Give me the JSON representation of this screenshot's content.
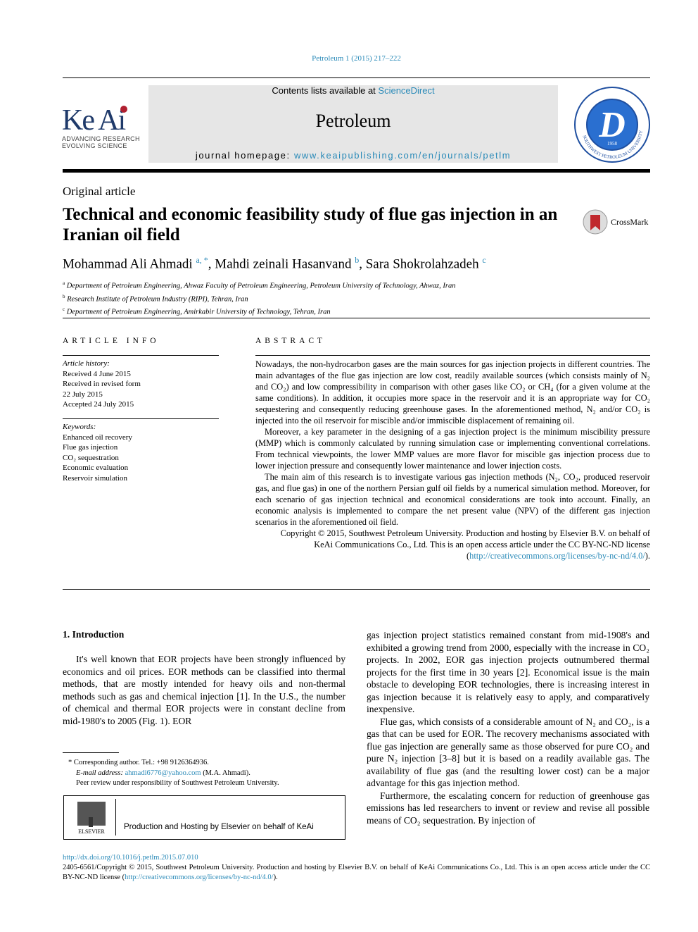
{
  "citation": "Petroleum 1 (2015) 217–222",
  "header": {
    "contents_prefix": "Contents lists available at ",
    "contents_link": "ScienceDirect",
    "journal": "Petroleum",
    "homepage_prefix": "journal homepage: ",
    "homepage_link": "www.keaipublishing.com/en/journals/petlm",
    "logo_keai": "Ke Ai",
    "logo_tag1": "ADVANCING RESEARCH",
    "logo_tag2": "EVOLVING SCIENCE",
    "seal_year": "1958",
    "seal_text": "SOUTHWEST PETROLEUM UNIVERSITY"
  },
  "article_type": "Original article",
  "title": "Technical and economic feasibility study of flue gas injection in an Iranian oil field",
  "crossmark": "CrossMark",
  "authors": [
    {
      "name": "Mohammad Ali Ahmadi",
      "sup": "a, *"
    },
    {
      "name": "Mahdi zeinali Hasanvand",
      "sup": "b"
    },
    {
      "name": "Sara Shokrolahzadeh",
      "sup": "c"
    }
  ],
  "affiliations": [
    {
      "sup": "a",
      "text": "Department of Petroleum Engineering, Ahwaz Faculty of Petroleum Engineering, Petroleum University of Technology, Ahwaz, Iran"
    },
    {
      "sup": "b",
      "text": "Research Institute of Petroleum Industry (RIPI), Tehran, Iran"
    },
    {
      "sup": "c",
      "text": "Department of Petroleum Engineering, Amirkabir University of Technology, Tehran, Iran"
    }
  ],
  "article_info": {
    "heading": "ARTICLE INFO",
    "history_label": "Article history:",
    "history": [
      "Received 4 June 2015",
      "Received in revised form",
      "22 July 2015",
      "Accepted 24 July 2015"
    ],
    "keywords_label": "Keywords:",
    "keywords": [
      "Enhanced oil recovery",
      "Flue gas injection",
      "CO₂ sequestration",
      "Economic evaluation",
      "Reservoir simulation"
    ]
  },
  "abstract": {
    "heading": "ABSTRACT",
    "paragraphs": [
      "Nowadays, the non-hydrocarbon gases are the main sources for gas injection projects in different countries. The main advantages of the flue gas injection are low cost, readily available sources (which consists mainly of N₂ and CO₂) and low compressibility in comparison with other gases like CO₂ or CH₄ (for a given volume at the same conditions). In addition, it occupies more space in the reservoir and it is an appropriate way for CO₂ sequestering and consequently reducing greenhouse gases. In the aforementioned method, N₂ and/or CO₂ is injected into the oil reservoir for miscible and/or immiscible displacement of remaining oil.",
      "Moreover, a key parameter in the designing of a gas injection project is the minimum miscibility pressure (MMP) which is commonly calculated by running simulation case or implementing conventional correlations. From technical viewpoints, the lower MMP values are more flavor for miscible gas injection process due to lower injection pressure and consequently lower maintenance and lower injection costs.",
      "The main aim of this research is to investigate various gas injection methods (N₂, CO₂, produced reservoir gas, and flue gas) in one of the northern Persian gulf oil fields by a numerical simulation method. Moreover, for each scenario of gas injection technical and economical considerations are took into account. Finally, an economic analysis is implemented to compare the net present value (NPV) of the different gas injection scenarios in the aforementioned oil field."
    ],
    "copyright": "Copyright © 2015, Southwest Petroleum University. Production and hosting by Elsevier B.V. on behalf of KeAi Communications Co., Ltd. This is an open access article under the CC BY-NC-ND license (",
    "license_link": "http://creativecommons.org/licenses/by-nc-nd/4.0/",
    "copyright_end": ")."
  },
  "intro": {
    "heading": "1.  Introduction",
    "left_paragraphs": [
      "It's well known that EOR projects have been strongly influenced by economics and oil prices. EOR methods can be classified into thermal methods, that are mostly intended for heavy oils and non-thermal methods such as gas and chemical injection [1]. In the U.S., the number of chemical and thermal EOR projects were in constant decline from mid-1980's to 2005 (Fig. 1). EOR"
    ],
    "right_paragraphs": [
      "gas injection project statistics remained constant from mid-1908's and exhibited a growing trend from 2000, especially with the increase in CO₂ projects. In 2002, EOR gas injection projects outnumbered thermal projects for the first time in 30 years [2]. Economical issue is the main obstacle to developing EOR technologies, there is increasing interest in gas injection because it is relatively easy to apply, and comparatively inexpensive.",
      "Flue gas, which consists of a considerable amount of N₂ and CO₂, is a gas that can be used for EOR. The recovery mechanisms associated with flue gas injection are generally same as those observed for pure CO₂ and pure N₂ injection [3–8] but it is based on a readily available gas. The availability of flue gas (and the resulting lower cost) can be a major advantage for this gas injection method.",
      "Furthermore, the escalating concern for reduction of greenhouse gas emissions has led researchers to invent or review and revise all possible means of CO₂ sequestration. By injection of"
    ]
  },
  "footnote": {
    "corr": "* Corresponding author. Tel.: +98 9126364936.",
    "email_label": "E-mail address: ",
    "email": "ahmadi6776@yahoo.com",
    "email_name": " (M.A. Ahmadi).",
    "peer": "Peer review under responsibility of Southwest Petroleum University."
  },
  "elsevier": {
    "logo": "ELSEVIER",
    "text": "Production and Hosting by Elsevier on behalf of KeAi"
  },
  "bottom": {
    "doi": "http://dx.doi.org/10.1016/j.petlm.2015.07.010",
    "text": "2405-6561/Copyright © 2015, Southwest Petroleum University. Production and hosting by Elsevier B.V. on behalf of KeAi Communications Co., Ltd. This is an open access article under the CC BY-NC-ND license (",
    "link": "http://creativecommons.org/licenses/by-nc-nd/4.0/",
    "end": ")."
  }
}
